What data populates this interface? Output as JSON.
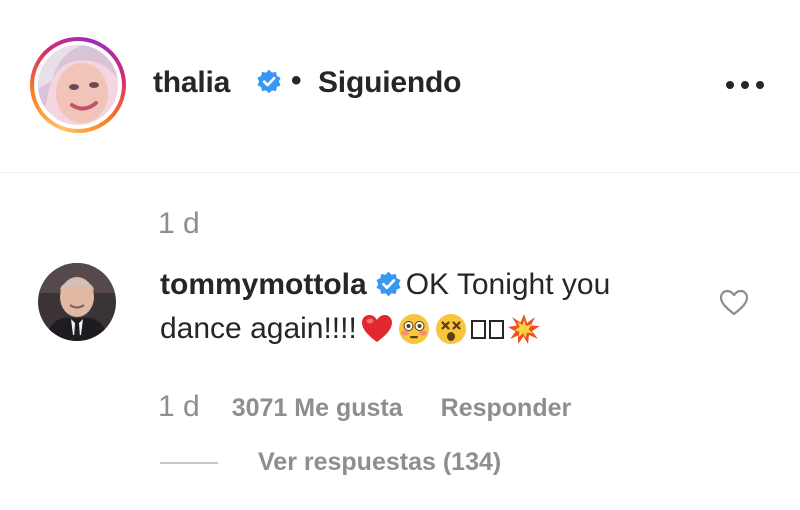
{
  "header": {
    "username": "thalia",
    "separator": "•",
    "follow_status": "Siguiendo",
    "more_icon": "more-horizontal-icon",
    "verified_color": "#3897f0",
    "avatar_ring_colors": [
      "#fdc468",
      "#fa7e1e",
      "#d62976",
      "#962fbf"
    ]
  },
  "comment": {
    "top_timestamp": "1 d",
    "username": "tommymottola",
    "text_line1": "OK Tonight you",
    "text_line2": "dance again!!!!",
    "emojis": [
      "red-heart-icon",
      "flushed-face-icon",
      "dizzy-face-icon",
      "unrendered-glyph-box-icon",
      "unrendered-glyph-box-icon",
      "collision-icon"
    ],
    "like_icon": "heart-outline-icon",
    "timestamp": "1 d",
    "likes_label": "3071 Me gusta",
    "reply_label": "Responder",
    "view_replies_label": "Ver respuestas (134)"
  }
}
